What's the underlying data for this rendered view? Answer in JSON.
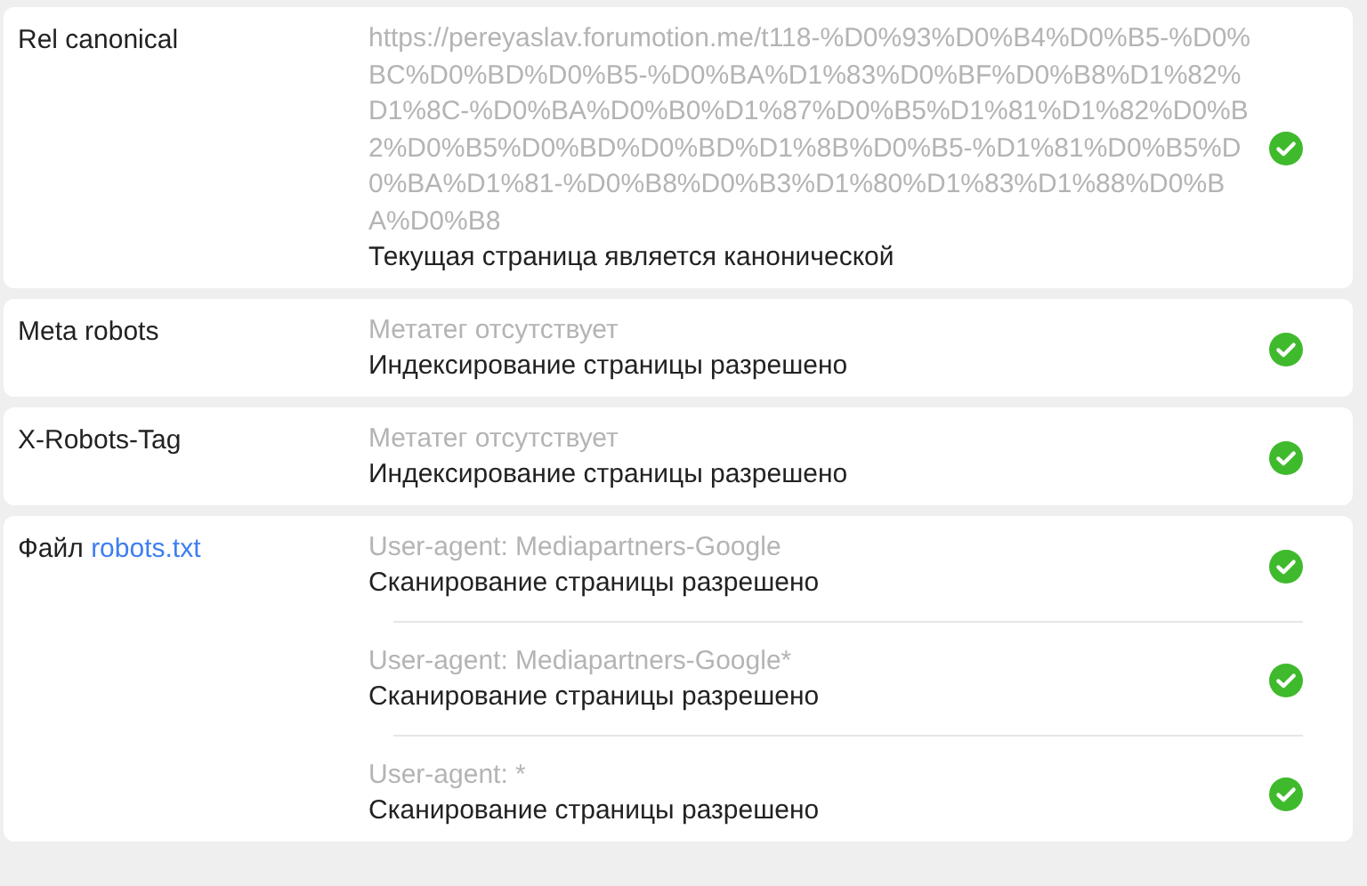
{
  "checks": [
    {
      "label": "Rel canonical",
      "entries": [
        {
          "note": "https://pereyaslav.forumotion.me/t118-%D0%93%D0%B4%D0%B5-%D0%BC%D0%BD%D0%B5-%D0%BA%D1%83%D0%BF%D0%B8%D1%82%D1%8C-%D0%BA%D0%B0%D1%87%D0%B5%D1%81%D1%82%D0%B2%D0%B5%D0%BD%D0%BD%D1%8B%D0%B5-%D1%81%D0%B5%D0%BA%D1%81-%D0%B8%D0%B3%D1%80%D1%83%D1%88%D0%BA%D0%B8",
          "status": "Текущая страница является канонической",
          "ok": true
        }
      ]
    },
    {
      "label": "Meta robots",
      "entries": [
        {
          "note": "Метатег отсутствует",
          "status": "Индексирование страницы разрешено",
          "ok": true
        }
      ]
    },
    {
      "label": "X-Robots-Tag",
      "entries": [
        {
          "note": "Метатег отсутствует",
          "status": "Индексирование страницы разрешено",
          "ok": true
        }
      ]
    },
    {
      "label": "Файл",
      "link": "robots.txt",
      "entries": [
        {
          "note": "User-agent: Mediapartners-Google",
          "status": "Сканирование страницы разрешено",
          "ok": true
        },
        {
          "note": "User-agent: Mediapartners-Google*",
          "status": "Сканирование страницы разрешено",
          "ok": true
        },
        {
          "note": "User-agent: *",
          "status": "Сканирование страницы разрешено",
          "ok": true
        }
      ]
    }
  ]
}
